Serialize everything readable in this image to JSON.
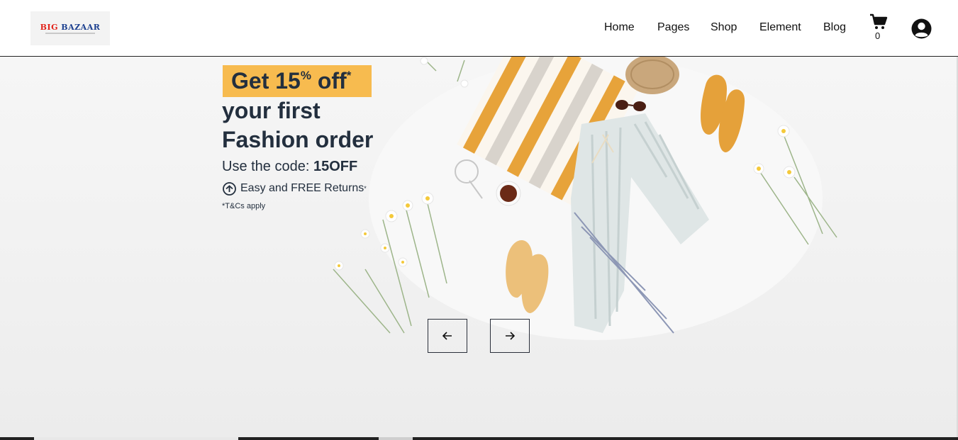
{
  "brand": {
    "logo_text_1": "BIG ",
    "logo_text_2": "BAZAAR",
    "colors": {
      "red": "#e2231a",
      "blue": "#1b3f8f"
    }
  },
  "nav": {
    "items": [
      {
        "label": "Home"
      },
      {
        "label": "Pages"
      },
      {
        "label": "Shop"
      },
      {
        "label": "Element"
      },
      {
        "label": "Blog"
      }
    ],
    "cart_count": "0",
    "cart_icon": "shopping-cart-icon",
    "account_icon": "user-account-icon"
  },
  "hero": {
    "badge_text": "Get 15",
    "badge_percent": "%",
    "badge_off": " off",
    "badge_star": "*",
    "line1": "your first",
    "line2": "Fashion order",
    "code_prefix": "Use the code: ",
    "code": "15OFF",
    "returns_text": "Easy and FREE Returns",
    "returns_star": "*",
    "terms": "*T&Cs apply",
    "badge_color": "#f7bb4f",
    "text_color": "#232f3e",
    "prev_icon": "arrow-left-icon",
    "next_icon": "arrow-right-icon"
  }
}
